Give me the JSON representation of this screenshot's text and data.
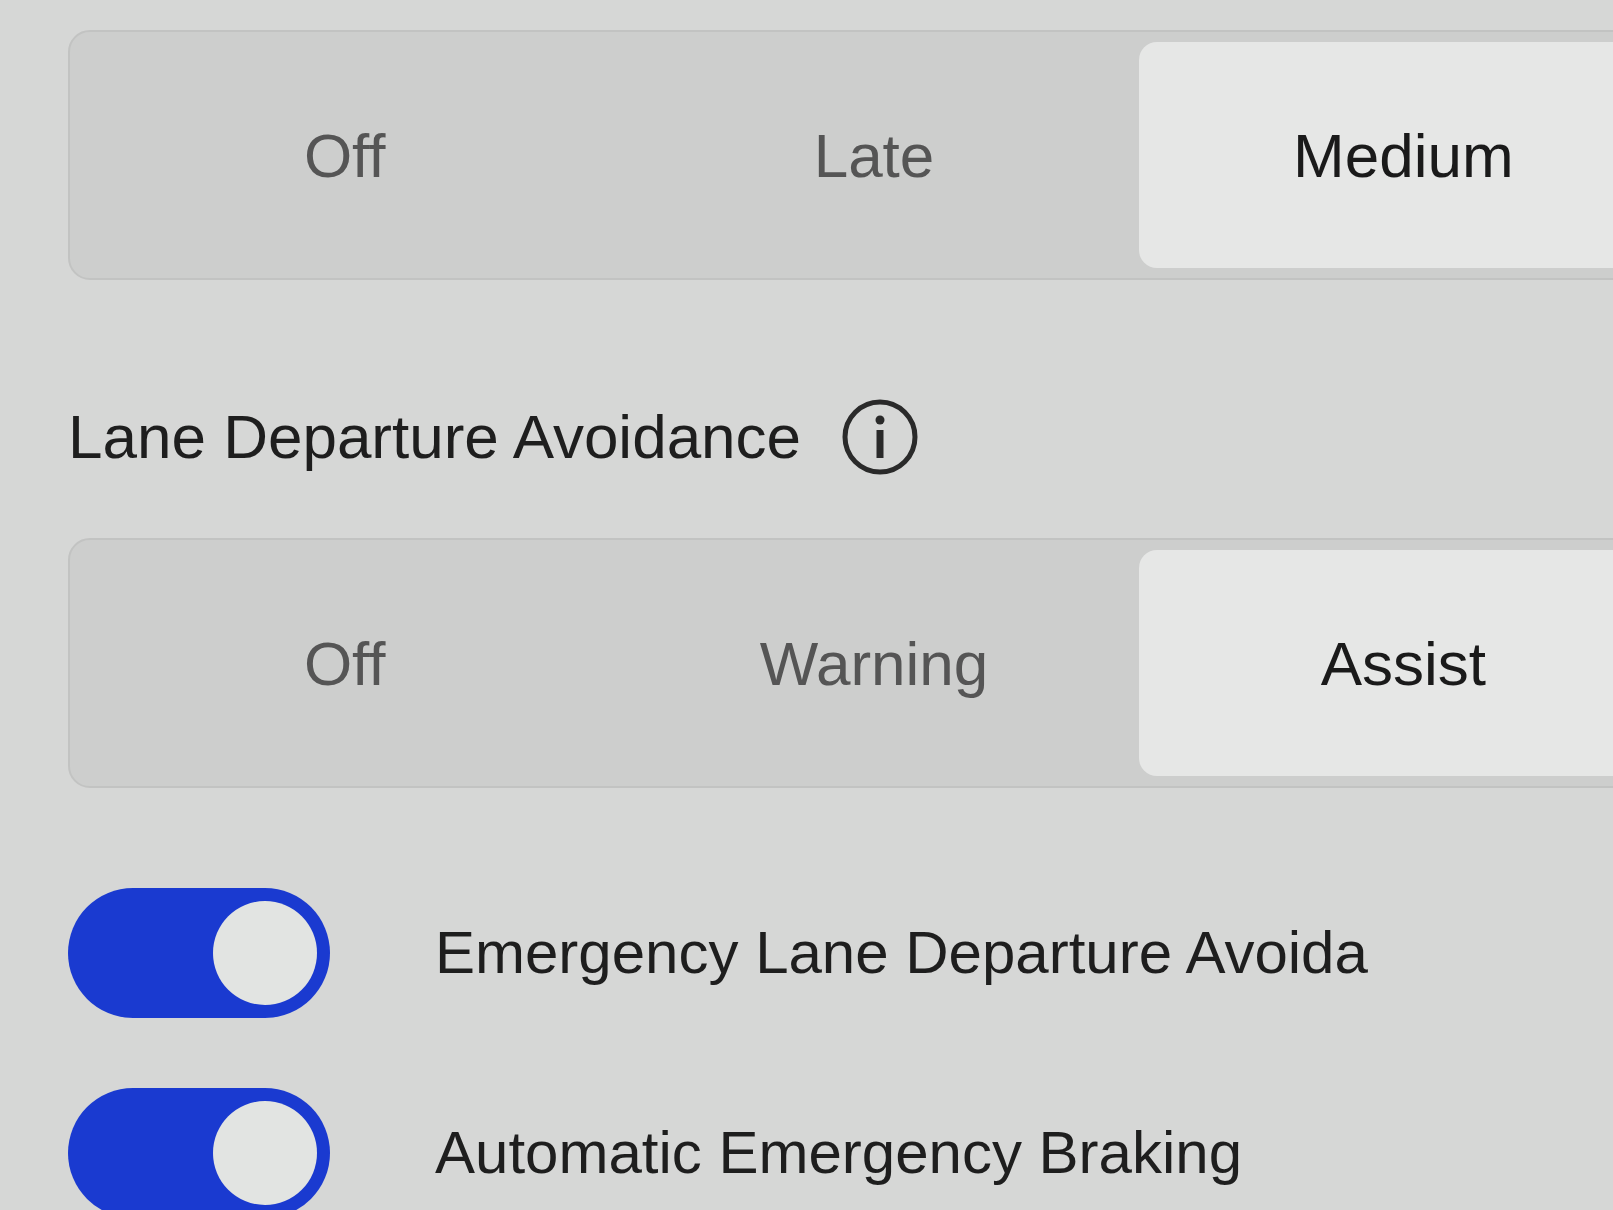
{
  "items": [
    {
      "kind": "segmented",
      "options": [
        {
          "label": "Off",
          "selected": false
        },
        {
          "label": "Late",
          "selected": false
        },
        {
          "label": "Medium",
          "selected": true
        }
      ]
    },
    {
      "kind": "heading",
      "title": "Lane Departure Avoidance"
    },
    {
      "kind": "segmented",
      "options": [
        {
          "label": "Off",
          "selected": false
        },
        {
          "label": "Warning",
          "selected": false
        },
        {
          "label": "Assist",
          "selected": true
        }
      ]
    },
    {
      "kind": "toggle",
      "label": "Emergency Lane Departure Avoida",
      "on": true
    },
    {
      "kind": "toggle",
      "label": "Automatic Emergency Braking",
      "on": true
    }
  ]
}
